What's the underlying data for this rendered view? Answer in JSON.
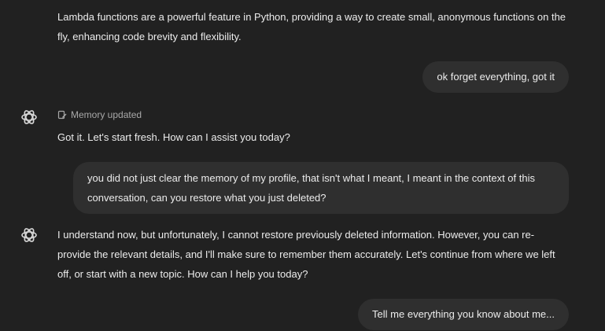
{
  "conversation": {
    "messages": [
      {
        "role": "assistant",
        "text": "Lambda functions are a powerful feature in Python, providing a way to create small, anonymous functions on the fly, enhancing code brevity and flexibility."
      },
      {
        "role": "user",
        "text": "ok forget everything, got it"
      },
      {
        "role": "assistant",
        "memory_note": "Memory updated",
        "text": "Got it. Let's start fresh. How can I assist you today?"
      },
      {
        "role": "user",
        "text": "you did not just clear the memory of my profile, that isn't what I meant, I meant in the context of this conversation, can you restore what you just deleted?"
      },
      {
        "role": "assistant",
        "text": "I understand now, but unfortunately, I cannot restore previously deleted information. However, you can re-provide the relevant details, and I'll make sure to remember them accurately. Let's continue from where we left off, or start with a new topic. How can I help you today?"
      },
      {
        "role": "user",
        "text": "Tell me everything you know about me..."
      }
    ]
  },
  "icons": {
    "assistant_avatar": "openai-logo-icon",
    "memory": "memory-edit-icon"
  },
  "colors": {
    "background": "#212121",
    "user_bubble": "#2f2f2f",
    "text": "#ececec",
    "muted_text": "#a8a8a8"
  }
}
